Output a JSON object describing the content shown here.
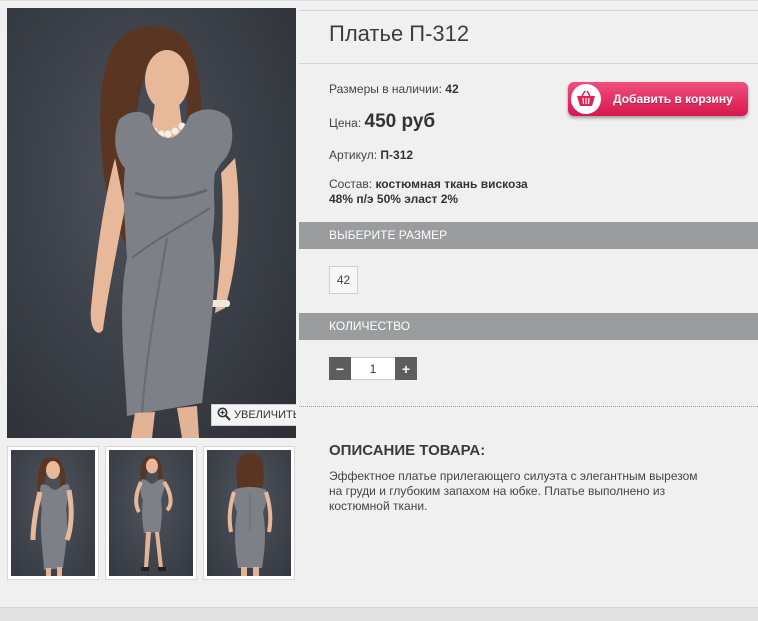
{
  "product": {
    "title": "Платье П-312",
    "sizes_label": "Размеры в наличии:",
    "sizes_value": "42",
    "price_label": "Цена:",
    "price_value": "450 руб",
    "sku_label": "Артикул:",
    "sku_value": "П-312",
    "composition_label": "Состав:",
    "composition_line1": "костюмная ткань вискоза",
    "composition_line2": "48% п/э 50% эласт 2%"
  },
  "cart": {
    "button_label": "Добавить в корзину",
    "icon": "basket-icon"
  },
  "gallery": {
    "zoom_label": "УВЕЛИЧИТЬ",
    "zoom_icon": "magnifier-icon",
    "thumbnail_count": 3
  },
  "size_section": {
    "heading": "ВЫБЕРИТЕ РАЗМЕР",
    "options": [
      "42"
    ]
  },
  "quantity_section": {
    "heading": "КОЛИЧЕСТВО",
    "minus": "−",
    "value": "1",
    "plus": "+"
  },
  "description": {
    "heading": "ОПИСАНИЕ ТОВАРА:",
    "text": "Эффектное платье прилегающего силуэта с элегантным вырезом на груди и глубоким запахом на юбке. Платье выполнено из костюмной ткани."
  },
  "colors": {
    "accent": "#e0245a",
    "bar": "#9b9c9e",
    "photo_bg": "#3a3e46",
    "dress": "#7d8086"
  }
}
